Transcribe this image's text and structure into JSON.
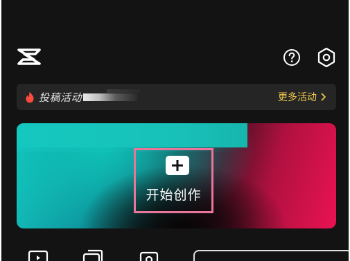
{
  "header": {
    "logo_icon": "capcut-logo-icon",
    "help_icon": "help-circle-icon",
    "settings_icon": "settings-hexagon-icon"
  },
  "activity_bar": {
    "label": "投稿活动",
    "icon": "fire-icon",
    "more_label": "更多活动",
    "more_icon": "chevron-right-icon"
  },
  "hero": {
    "create_label": "开始创作",
    "create_icon": "plus-icon"
  },
  "colors": {
    "background": "#131313",
    "bar_background": "#252525",
    "accent_yellow": "#f2c94c",
    "fire_red": "#ff4b3e",
    "teal": "#14c8c0",
    "magenta": "#ea1252",
    "highlight_box": "#e7769a"
  }
}
